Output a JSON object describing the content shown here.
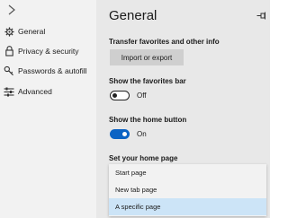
{
  "sidebar": {
    "items": [
      {
        "label": "General",
        "icon": "gear-icon"
      },
      {
        "label": "Privacy & security",
        "icon": "lock-icon"
      },
      {
        "label": "Passwords & autofill",
        "icon": "key-icon"
      },
      {
        "label": "Advanced",
        "icon": "sliders-icon"
      }
    ]
  },
  "main": {
    "title": "General",
    "transfer": {
      "label": "Transfer favorites and other info",
      "button": "Import or export"
    },
    "favorites_bar": {
      "label": "Show the favorites bar",
      "state": "Off"
    },
    "home_button": {
      "label": "Show the home button",
      "state": "On"
    },
    "home_page": {
      "label": "Set your home page",
      "options": [
        "Start page",
        "New tab page",
        "A specific page"
      ],
      "selected": "A specific page"
    }
  },
  "colors": {
    "accent": "#0b63c4",
    "sidebar_bg": "#f2f2f2",
    "main_bg": "#e8e8e8",
    "selected_option": "#cce4f7"
  }
}
